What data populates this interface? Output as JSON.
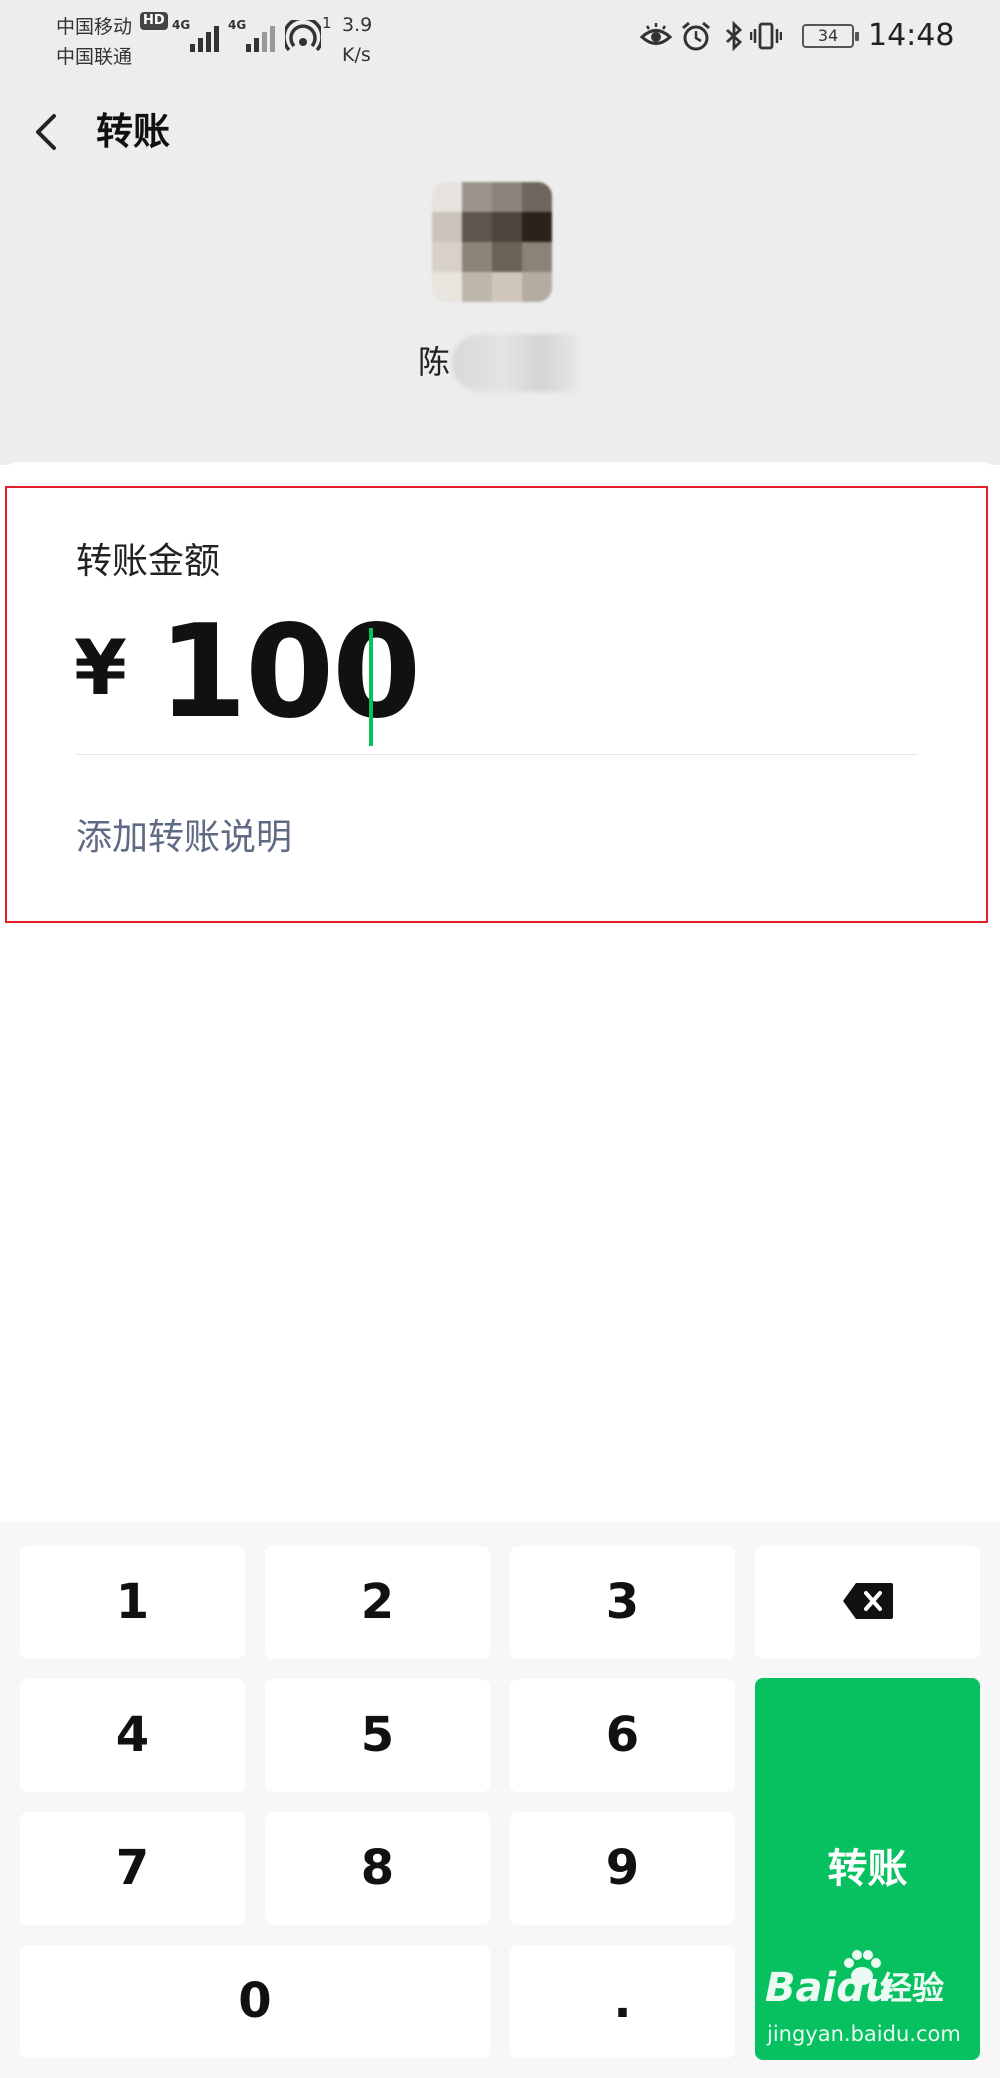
{
  "status_bar": {
    "carrier_1": "中国移动",
    "carrier_2": "中国联通",
    "hd_badge": "HD",
    "network_1": "4G",
    "network_2": "4G",
    "wifi_count": "1",
    "speed_value": "3.9",
    "speed_unit": "K/s",
    "battery": "34",
    "time": "14:48",
    "icons": [
      "eye-icon",
      "alarm-icon",
      "bluetooth-icon",
      "vibrate-icon",
      "battery-icon"
    ]
  },
  "header": {
    "back_icon": "chevron-left-icon",
    "title": "转账"
  },
  "recipient": {
    "name": "陈"
  },
  "transfer": {
    "amount_label": "转账金额",
    "currency_symbol": "¥",
    "amount": "100",
    "add_note_label": "添加转账说明"
  },
  "keypad": {
    "keys": [
      "1",
      "2",
      "3",
      "4",
      "5",
      "6",
      "7",
      "8",
      "9",
      "0",
      "."
    ],
    "backspace_icon": "backspace-icon",
    "submit_label": "转账",
    "accent_color": "#07c160"
  },
  "watermark": {
    "brand": "Baidu",
    "cn": "经验",
    "url": "jingyan.baidu.com"
  }
}
